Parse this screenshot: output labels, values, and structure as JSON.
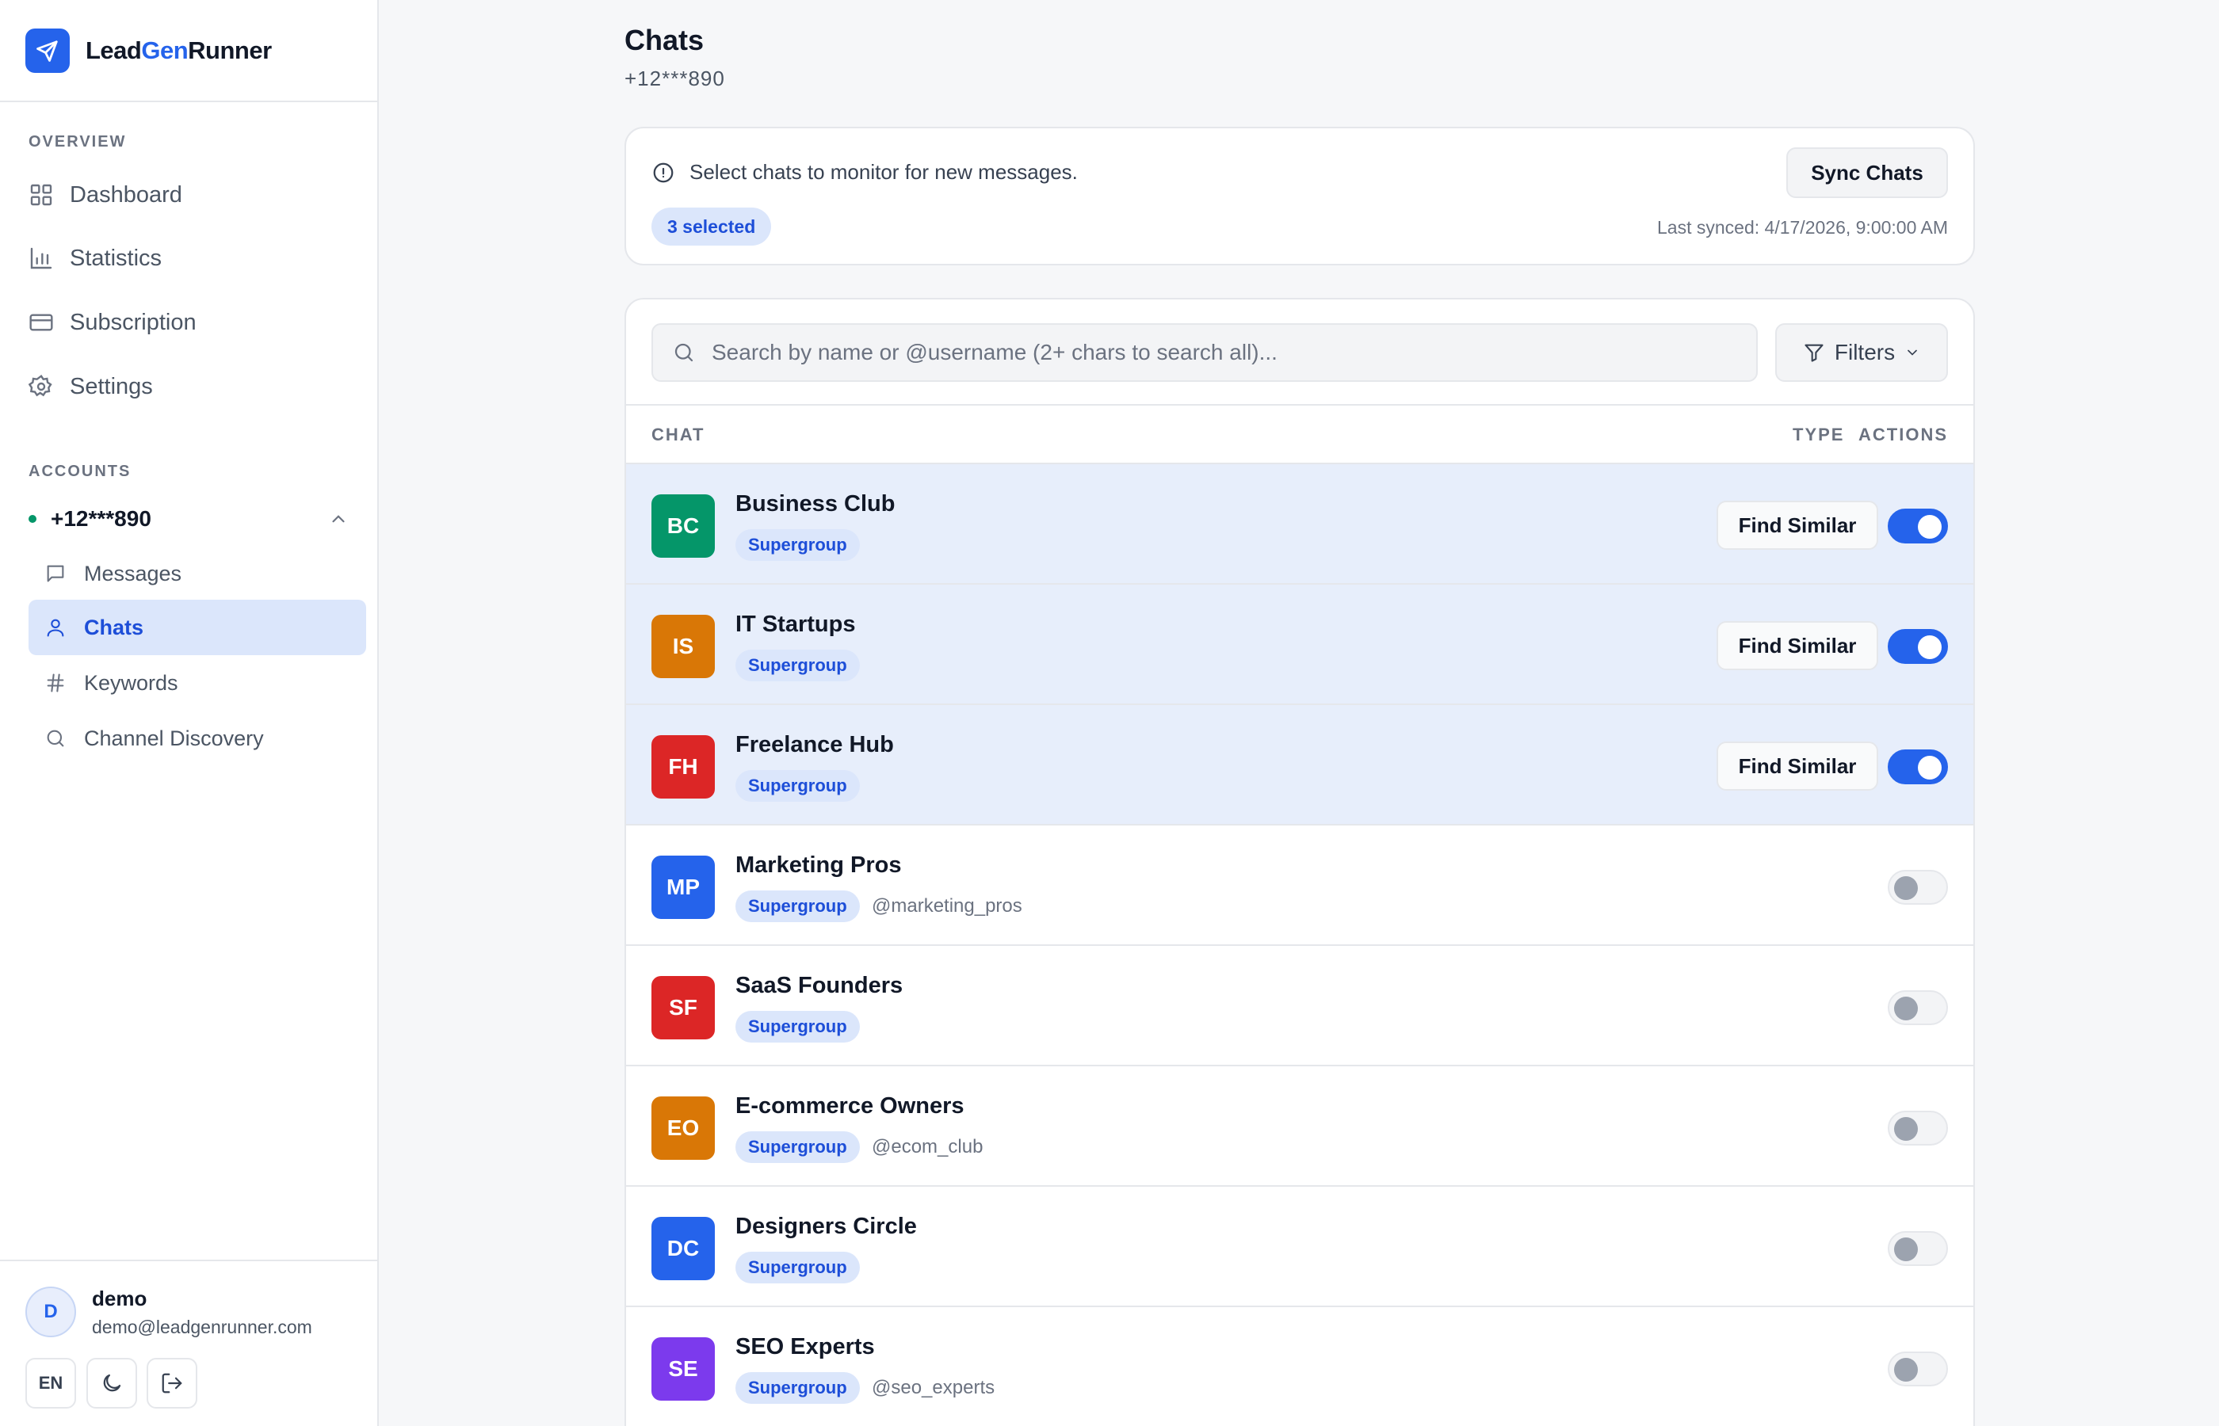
{
  "app": {
    "brand_prefix": "Lead",
    "brand_highlight": "Gen",
    "brand_suffix": "Runner"
  },
  "sidebar": {
    "overview_label": "OVERVIEW",
    "nav": [
      {
        "label": "Dashboard",
        "icon": "grid-icon"
      },
      {
        "label": "Statistics",
        "icon": "bar-chart-icon"
      },
      {
        "label": "Subscription",
        "icon": "credit-card-icon"
      },
      {
        "label": "Settings",
        "icon": "gear-icon"
      }
    ],
    "accounts_label": "ACCOUNTS",
    "account": {
      "phone": "+12***890",
      "status_color": "#059669"
    },
    "sub_nav": [
      {
        "label": "Messages",
        "icon": "message-icon",
        "active": false
      },
      {
        "label": "Chats",
        "icon": "user-icon",
        "active": true
      },
      {
        "label": "Keywords",
        "icon": "hash-icon",
        "active": false
      },
      {
        "label": "Channel Discovery",
        "icon": "search-icon",
        "active": false
      }
    ],
    "user": {
      "initial": "D",
      "name": "demo",
      "email": "demo@leadgenrunner.com"
    },
    "footer_buttons": {
      "language": "EN"
    }
  },
  "main": {
    "title": "Chats",
    "subtitle": "+12***890",
    "info": {
      "text": "Select chats to monitor for new messages.",
      "selected_badge": "3 selected",
      "sync_label": "Sync Chats",
      "last_synced": "Last synced: 4/17/2026, 9:00:00 AM"
    },
    "search": {
      "placeholder": "Search by name or @username (2+ chars to search all)..."
    },
    "filters_label": "Filters",
    "columns": {
      "chat": "CHAT",
      "type": "TYPE",
      "actions": "ACTIONS"
    },
    "find_similar_label": "Find Similar",
    "rows": [
      {
        "initials": "BC",
        "name": "Business Club",
        "type": "Supergroup",
        "username": "",
        "color": "#059669",
        "enabled": true
      },
      {
        "initials": "IS",
        "name": "IT Startups",
        "type": "Supergroup",
        "username": "",
        "color": "#d97706",
        "enabled": true
      },
      {
        "initials": "FH",
        "name": "Freelance Hub",
        "type": "Supergroup",
        "username": "",
        "color": "#dc2626",
        "enabled": true
      },
      {
        "initials": "MP",
        "name": "Marketing Pros",
        "type": "Supergroup",
        "username": "@marketing_pros",
        "color": "#2563eb",
        "enabled": false
      },
      {
        "initials": "SF",
        "name": "SaaS Founders",
        "type": "Supergroup",
        "username": "",
        "color": "#dc2626",
        "enabled": false
      },
      {
        "initials": "EO",
        "name": "E-commerce Owners",
        "type": "Supergroup",
        "username": "@ecom_club",
        "color": "#d97706",
        "enabled": false
      },
      {
        "initials": "DC",
        "name": "Designers Circle",
        "type": "Supergroup",
        "username": "",
        "color": "#2563eb",
        "enabled": false
      },
      {
        "initials": "SE",
        "name": "SEO Experts",
        "type": "Supergroup",
        "username": "@seo_experts",
        "color": "#7c3aed",
        "enabled": false
      }
    ]
  },
  "colors": {
    "accent": "#2563eb",
    "selected_row": "#e7eefb",
    "online": "#059669"
  }
}
